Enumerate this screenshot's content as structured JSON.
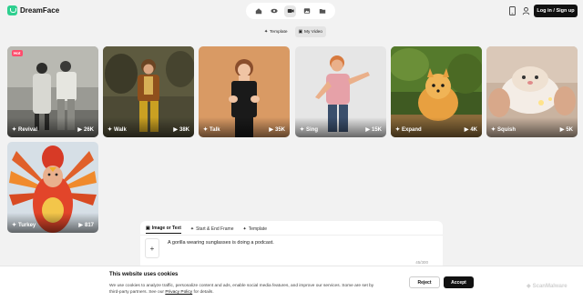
{
  "header": {
    "logo_text": "DreamFace",
    "login_label": "Log in / Sign up",
    "nav_icons": [
      "home-icon",
      "eye-icon",
      "video-icon",
      "image-icon",
      "folder-icon"
    ],
    "active_nav": "video-icon"
  },
  "subtabs": [
    {
      "label": "Template",
      "icon": "sparkle-icon",
      "active": false
    },
    {
      "label": "My Video",
      "icon": "video-icon",
      "active": true
    }
  ],
  "cards": [
    {
      "label": "Revival",
      "count": "26K",
      "badge": "Hot"
    },
    {
      "label": "Walk",
      "count": "38K",
      "badge": ""
    },
    {
      "label": "Talk",
      "count": "35K",
      "badge": ""
    },
    {
      "label": "Sing",
      "count": "15K",
      "badge": ""
    },
    {
      "label": "Expand",
      "count": "4K",
      "badge": ""
    },
    {
      "label": "Squish",
      "count": "5K",
      "badge": ""
    },
    {
      "label": "Turkey",
      "count": "817",
      "badge": ""
    }
  ],
  "prompt": {
    "tabs": [
      {
        "label": "Image or Text",
        "active": true
      },
      {
        "label": "Start & End Frame",
        "active": false
      },
      {
        "label": "Template",
        "active": false
      }
    ],
    "add_label": "+",
    "text": "A gorilla wearing sunglasses is doing a podcast.",
    "char_count": "45/300"
  },
  "cookie": {
    "title": "This website uses cookies",
    "text": "We use cookies to analyze traffic, personalize content and ads, enable social media features, and improve our services. Some are set by third-party partners. See our",
    "link": "Privacy Policy",
    "suffix": " for details.",
    "reject_label": "Reject",
    "accept_label": "Accept"
  },
  "watermark": "ScanMalware"
}
